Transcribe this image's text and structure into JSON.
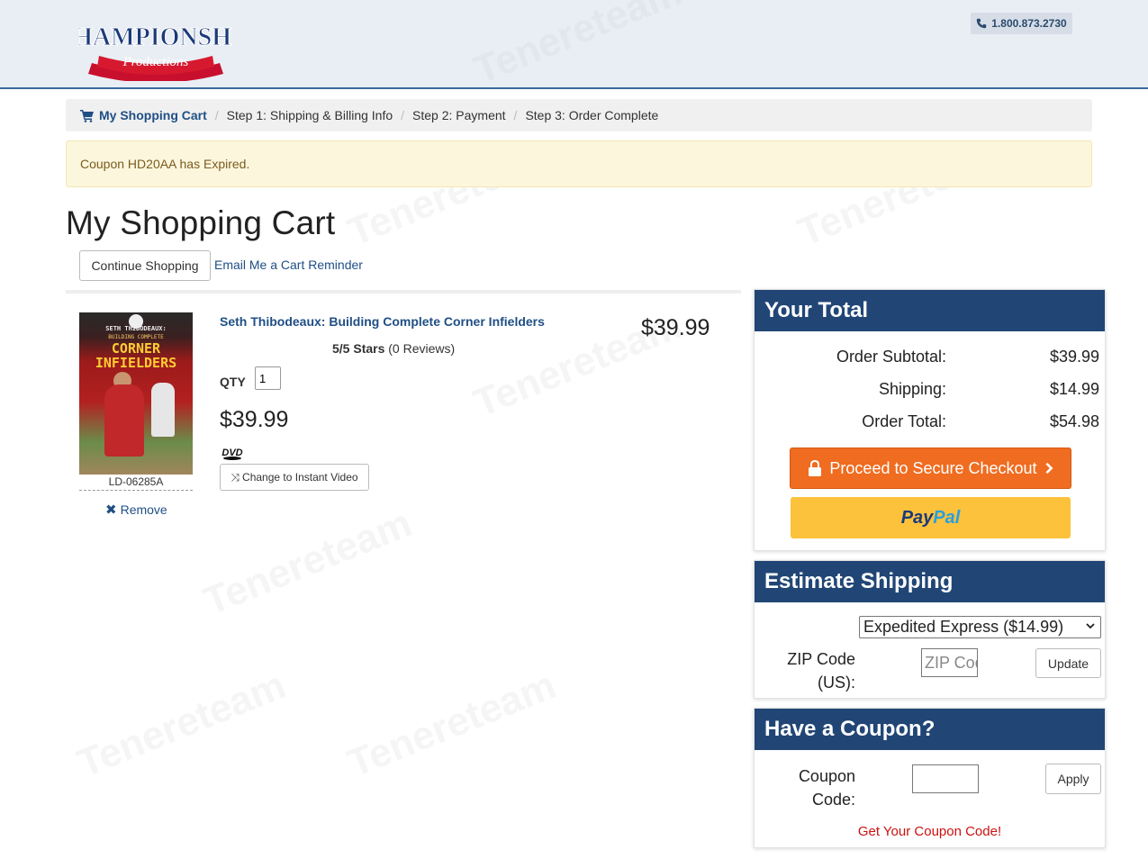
{
  "header": {
    "logo_text": "CHAMPIONSHIP",
    "logo_sub": "Productions",
    "phone": "1.800.873.2730"
  },
  "breadcrumb": {
    "active": "My Shopping Cart",
    "step1": "Step 1: Shipping & Billing Info",
    "step2": "Step 2: Payment",
    "step3": "Step 3: Order Complete"
  },
  "alert": "Coupon HD20AA has Expired.",
  "page": {
    "title": "My Shopping Cart",
    "continue_label": "Continue Shopping",
    "email_link": "Email Me a Cart Reminder"
  },
  "product": {
    "cover_line1": "SETH THIBODEAUX:",
    "cover_line2": "BUILDING COMPLETE",
    "cover_line3a": "CORNER",
    "cover_line3b": "INFIELDERS",
    "sku": "LD-06285A",
    "remove_label": "Remove",
    "name": "Seth Thibodeaux: Building Complete Corner Infielders",
    "rating_stars": "5/5 Stars",
    "rating_reviews": "(0 Reviews)",
    "qty_label": "QTY",
    "qty": "1",
    "price": "$39.99",
    "change_label": "Change to Instant Video",
    "line_price": "$39.99"
  },
  "totals": {
    "heading": "Your Total",
    "subtotal_label": "Order Subtotal:",
    "subtotal": "$39.99",
    "shipping_label": "Shipping:",
    "shipping": "$14.99",
    "total_label": "Order Total:",
    "total": "$54.98",
    "checkout_label": "Proceed to Secure Checkout",
    "paypal_a": "Pay",
    "paypal_b": "Pal"
  },
  "shipping": {
    "heading": "Estimate Shipping",
    "selected_option": "Expedited Express ($14.99)",
    "zip_label_1": "ZIP Code",
    "zip_label_2": "(US):",
    "zip_placeholder": "ZIP Code",
    "update_label": "Update"
  },
  "coupon": {
    "heading": "Have a Coupon?",
    "label_1": "Coupon",
    "label_2": "Code:",
    "apply_label": "Apply",
    "link": "Get Your Coupon Code!"
  },
  "colors": {
    "brand_blue": "#214676",
    "link_blue": "#1f4f85",
    "checkout_orange": "#ef6c20",
    "paypal_yellow": "#fcc23b",
    "coupon_red": "#cc1111"
  }
}
